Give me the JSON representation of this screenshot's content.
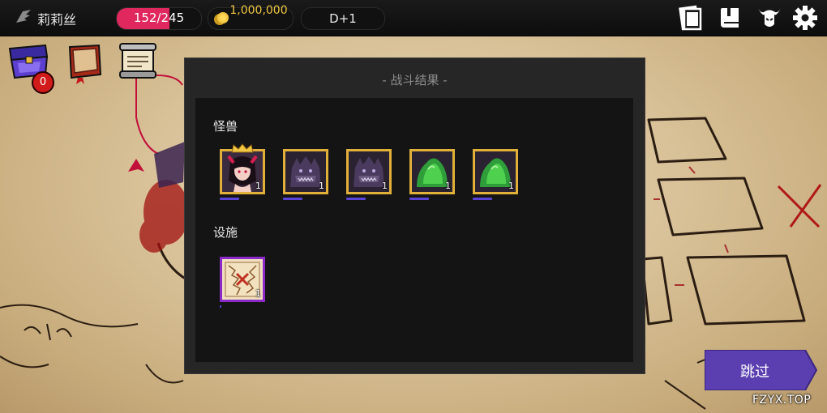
{
  "topbar": {
    "player_name": "莉莉丝",
    "hp": {
      "current": 152,
      "max": 245,
      "text": "152/245"
    },
    "gold_text": "1,000,000",
    "day_text": "D+1",
    "icons": [
      "card-icon",
      "book-icon",
      "demon-helmet-icon",
      "gear-icon"
    ]
  },
  "side_items": {
    "chest_badge": "0",
    "icons": [
      "purple-chest-icon",
      "red-book-icon",
      "scroll-icon"
    ]
  },
  "modal": {
    "title": "- 战斗结果 -",
    "monsters_label": "怪兽",
    "monsters": [
      {
        "icon": "succubus-portrait-icon",
        "count": "1",
        "crown": true
      },
      {
        "icon": "shadow-beast-icon",
        "count": "1",
        "crown": false
      },
      {
        "icon": "shadow-beast-icon",
        "count": "1",
        "crown": false
      },
      {
        "icon": "green-slime-icon",
        "count": "1",
        "crown": false
      },
      {
        "icon": "green-slime-icon",
        "count": "1",
        "crown": false
      }
    ],
    "facilities_label": "设施",
    "facilities": [
      {
        "icon": "trap-map-icon",
        "count": "1"
      }
    ]
  },
  "skip_button": {
    "label": "跳过"
  },
  "watermark": "FZYX.TOP",
  "colors": {
    "hp_fill": "#e0285f",
    "gold": "#f0c840",
    "skip_button": "#5b3fb0",
    "slot_frame": "#e0b03a",
    "facility_frame": "#8b2ac9"
  }
}
